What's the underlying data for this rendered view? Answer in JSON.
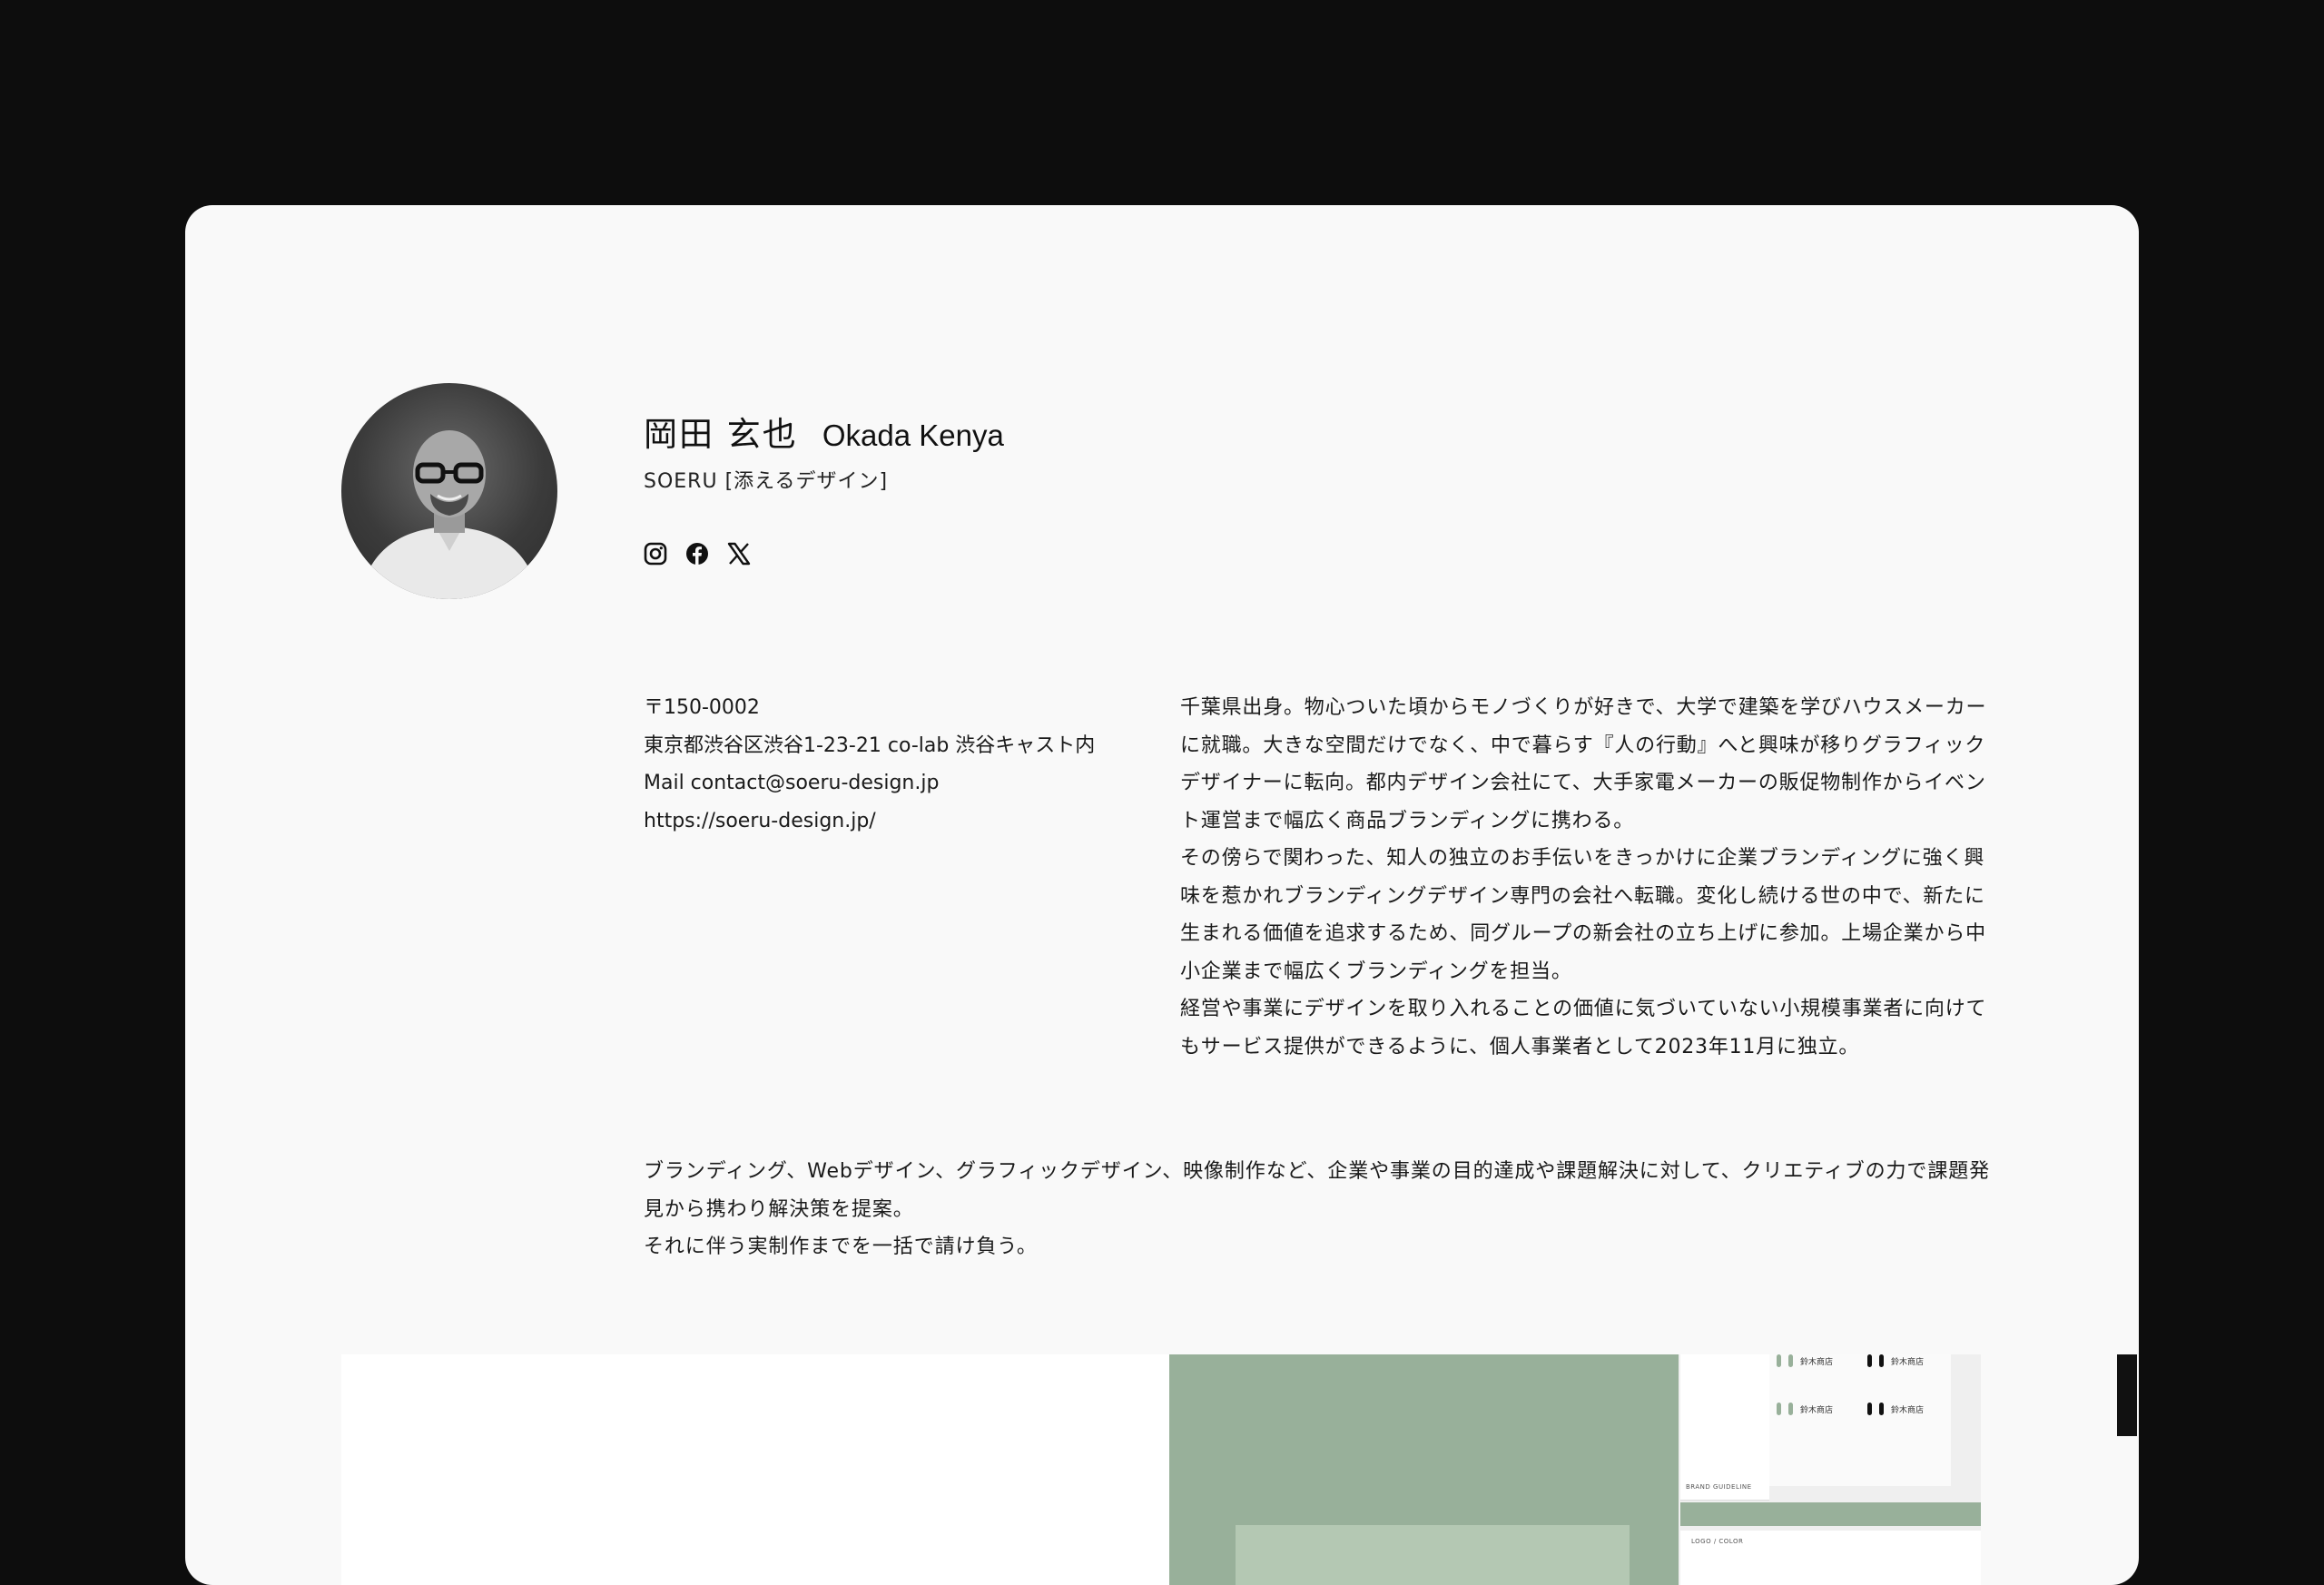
{
  "profile": {
    "name_jp": "岡田 玄也",
    "name_en": "Okada Kenya",
    "company": "SOERU [添えるデザイン]",
    "social": [
      {
        "icon": "instagram-icon"
      },
      {
        "icon": "facebook-icon"
      },
      {
        "icon": "x-icon"
      }
    ]
  },
  "contact": {
    "postal": "〒150-0002",
    "address": "東京都渋谷区渋谷1-23-21 co-lab 渋谷キャスト内",
    "mail": "Mail contact@soeru-design.jp",
    "url": "https://soeru-design.jp/"
  },
  "bio": [
    "千葉県出身。物心ついた頃からモノづくりが好きで、大学で建築を学びハウスメーカーに就職。大きな空間だけでなく、中で暮らす『人の行動』へと興味が移りグラフィックデザイナーに転向。都内デザイン会社にて、大手家電メーカーの販促物制作からイベント運営まで幅広く商品ブランディングに携わる。",
    "その傍らで関わった、知人の独立のお手伝いをきっかけに企業ブランディングに強く興味を惹かれブランディングデザイン専門の会社へ転職。変化し続ける世の中で、新たに生まれる価値を追求するため、同グループの新会社の立ち上げに参加。上場企業から中小企業まで幅広くブランディングを担当。",
    "経営や事業にデザインを取り入れることの価値に気づいていない小規模事業者に向けてもサービス提供ができるように、個人事業者として2023年11月に独立。"
  ],
  "services": [
    "ブランディング、Webデザイン、グラフィックデザイン、映像制作など、企業や事業の目的達成や課題解決に対して、クリエティブの力で課題発見から携わり解決策を提案。",
    "それに伴う実制作までを一括で請け負う。"
  ],
  "showcase": {
    "logo_text": "鈴木商店",
    "caption_left": "BRAND GUIDELINE",
    "caption_bottom": "LOGO / COLOR"
  },
  "colors": {
    "background": "#0d0d0d",
    "card": "#f9f9f9",
    "accent_green": "#98b09a"
  }
}
